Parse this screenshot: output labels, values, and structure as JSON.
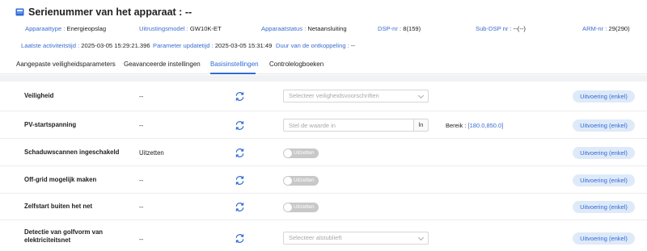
{
  "header": {
    "title": "Serienummer van het apparaat : --",
    "info_row_1": [
      {
        "label": "Apparaattype : ",
        "value": "Energieopslag"
      },
      {
        "label": "Uitrustingsmodel : ",
        "value": "GW10K-ET"
      },
      {
        "label": "Apparaatstatus : ",
        "value": "Netaansluiting"
      },
      {
        "label": "DSP-nr : ",
        "value": "8(159)"
      },
      {
        "label": "Sub-DSP nr : ",
        "value": "--(--)"
      },
      {
        "label": "ARM-nr : ",
        "value": "29(290)"
      }
    ],
    "info_row_2": [
      {
        "label": "Laatste activiteitstijd : ",
        "value": "2025-03-05 15:29:21.396"
      },
      {
        "label": "Parameter updatetijd : ",
        "value": "2025-03-05 15:31:49"
      },
      {
        "label": "Duur van de ontkoppeling : ",
        "value": "--"
      }
    ]
  },
  "tabs": [
    {
      "label": "Aangepaste veiligheidsparameters",
      "active": false
    },
    {
      "label": "Geavanceerde instellingen",
      "active": false
    },
    {
      "label": "Basisinstellingen",
      "active": true
    },
    {
      "label": "Controlelogboeken",
      "active": false
    }
  ],
  "rows": [
    {
      "name": "Veiligheid",
      "value": "--",
      "control": "select",
      "placeholder": "Selecteer veiligheidsvoorschriften",
      "button": "Uitvoering (enkel)"
    },
    {
      "name": "PV-startspanning",
      "value": "--",
      "control": "input",
      "placeholder": "Stel de waarde in",
      "unit": "ln",
      "range_label": "Bereik : ",
      "range_value": "[180.0,850.0]",
      "button": "Uitvoering (enkel)"
    },
    {
      "name": "Schaduwscannen ingeschakeld",
      "value": "Uitzetten",
      "control": "toggle",
      "toggle_label": "Uitzetten",
      "button": "Uitvoering (enkel)"
    },
    {
      "name": "Off-grid mogelijk maken",
      "value": "--",
      "control": "toggle",
      "toggle_label": "Uitzetten",
      "button": "Uitvoering (enkel)"
    },
    {
      "name": "Zelfstart buiten het net",
      "value": "--",
      "control": "toggle",
      "toggle_label": "Uitzetten",
      "button": "Uitvoering (enkel)"
    },
    {
      "name": "Detectie van golfvorm van elektriciteitsnet",
      "value": "--",
      "control": "select",
      "placeholder": "Selecteer alstublieft",
      "button": "Uitvoering (enkel)"
    }
  ],
  "colors": {
    "accent": "#2f6bd6",
    "label_blue": "#3a6ed0",
    "button_bg": "#dfeaf9",
    "toggle_off": "#c8c8c8"
  },
  "icons": {
    "device": "device-icon",
    "refresh": "refresh-icon",
    "dropdown": "chevron-down-icon"
  }
}
